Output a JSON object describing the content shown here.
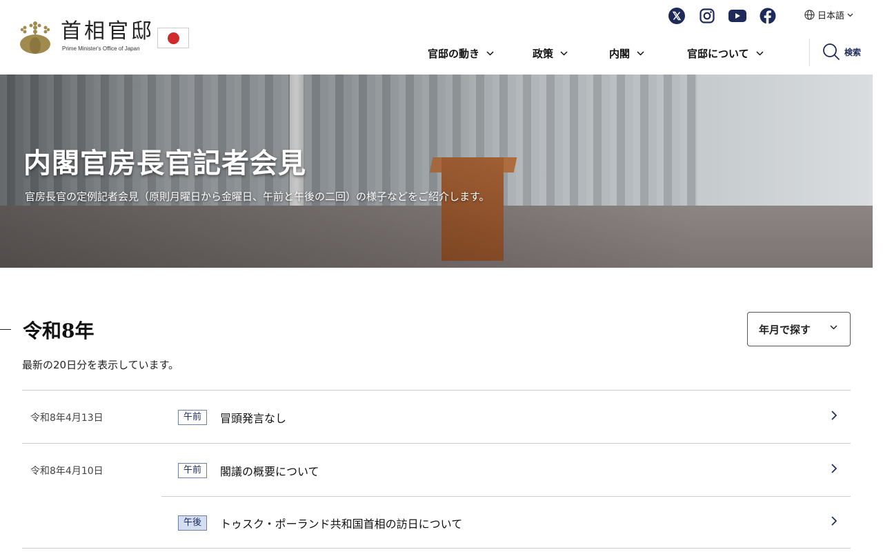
{
  "header": {
    "logo_title": "首相官邸",
    "logo_subtitle": "Prime Minister's Office of Japan",
    "social": [
      "x-icon",
      "instagram-icon",
      "youtube-icon",
      "facebook-icon"
    ],
    "language": "日本語",
    "nav": [
      {
        "label": "官邸の動き"
      },
      {
        "label": "政策"
      },
      {
        "label": "内閣"
      },
      {
        "label": "官邸について"
      }
    ],
    "search_label": "検索"
  },
  "hero": {
    "title": "内閣官房長官記者会見",
    "description": "官房長官の定例記者会見（原則月曜日から金曜日、午前と午後の二回）の様子などをご紹介します。"
  },
  "main": {
    "year_title": "令和8年",
    "find_button": "年月で探す",
    "note": "最新の20日分を表示しています。",
    "rows": [
      {
        "date": "令和8年4月13日",
        "tag": "午前",
        "title": "冒頭発言なし"
      },
      {
        "date": "令和8年4月10日",
        "tag": "午前",
        "title": "閣議の概要について"
      },
      {
        "date": "",
        "tag": "午後",
        "title": "トゥスク・ポーランド共和国首相の訪日について"
      }
    ]
  },
  "colors": {
    "navy": "#1d2a5a",
    "flag_red": "#d02b2b",
    "gold": "#a08a4e"
  }
}
